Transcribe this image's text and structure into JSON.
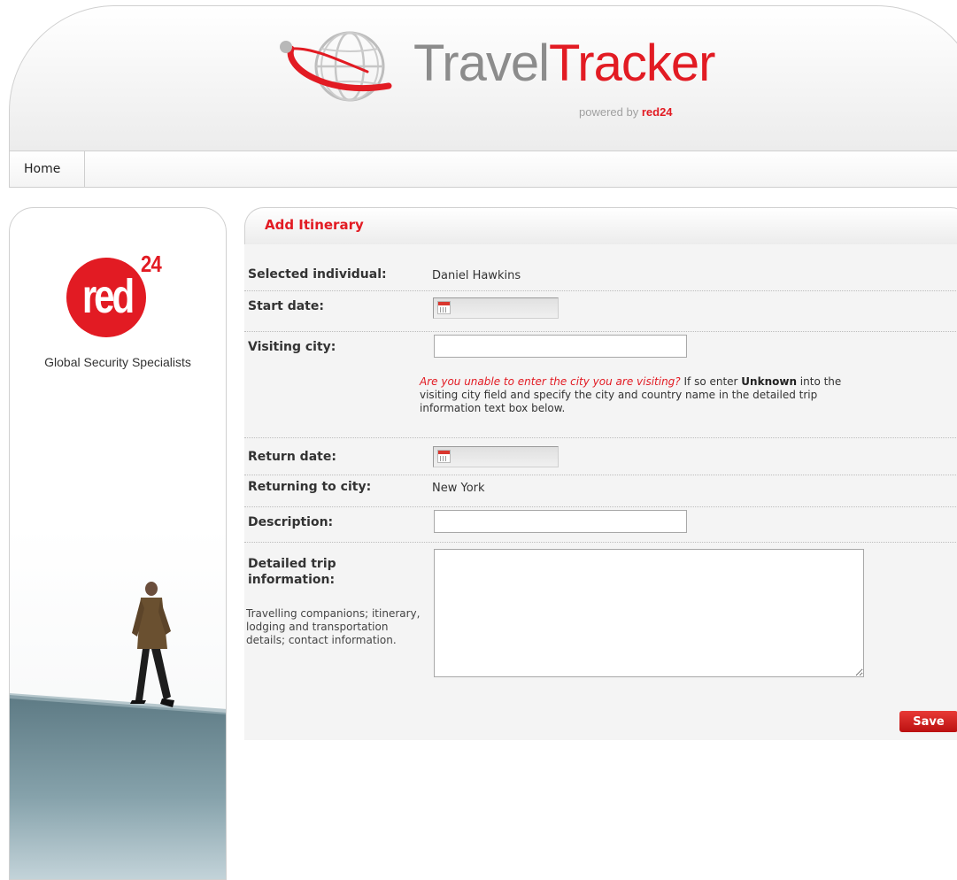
{
  "brand": {
    "word_part1": "Travel",
    "word_part2": "Tracker",
    "powered_by": "powered by",
    "powered_brand": "red24",
    "red_color": "#e21b23",
    "grey_color": "#8c8c8c"
  },
  "nav": {
    "home_label": "Home"
  },
  "sidebar": {
    "logo_text": "red",
    "logo_superscript": "24",
    "tagline": "Global Security Specialists",
    "photo_icon": "man-walking-photo"
  },
  "panel": {
    "title": "Add Itinerary"
  },
  "form": {
    "selected_individual": {
      "label": "Selected individual:",
      "value": "Daniel Hawkins"
    },
    "start_date": {
      "label": "Start date:",
      "value": "",
      "icon": "calendar-icon"
    },
    "visiting_city": {
      "label": "Visiting city:",
      "value": "",
      "note_question": "Are you unable to enter the city you are visiting?",
      "note_part1": " If so enter ",
      "note_bold": "Unknown",
      "note_part2": " into the visiting city field and specify the city and country name in the detailed trip information text box below."
    },
    "return_date": {
      "label": "Return date:",
      "value": "",
      "icon": "calendar-icon"
    },
    "returning_city": {
      "label": "Returning to city:",
      "value": "New York"
    },
    "description": {
      "label": "Description:",
      "value": ""
    },
    "details": {
      "label": "Detailed trip information:",
      "hint": "Travelling companions; itinerary, lodging and transportation details; contact information.",
      "value": ""
    },
    "save_label": "Save"
  }
}
